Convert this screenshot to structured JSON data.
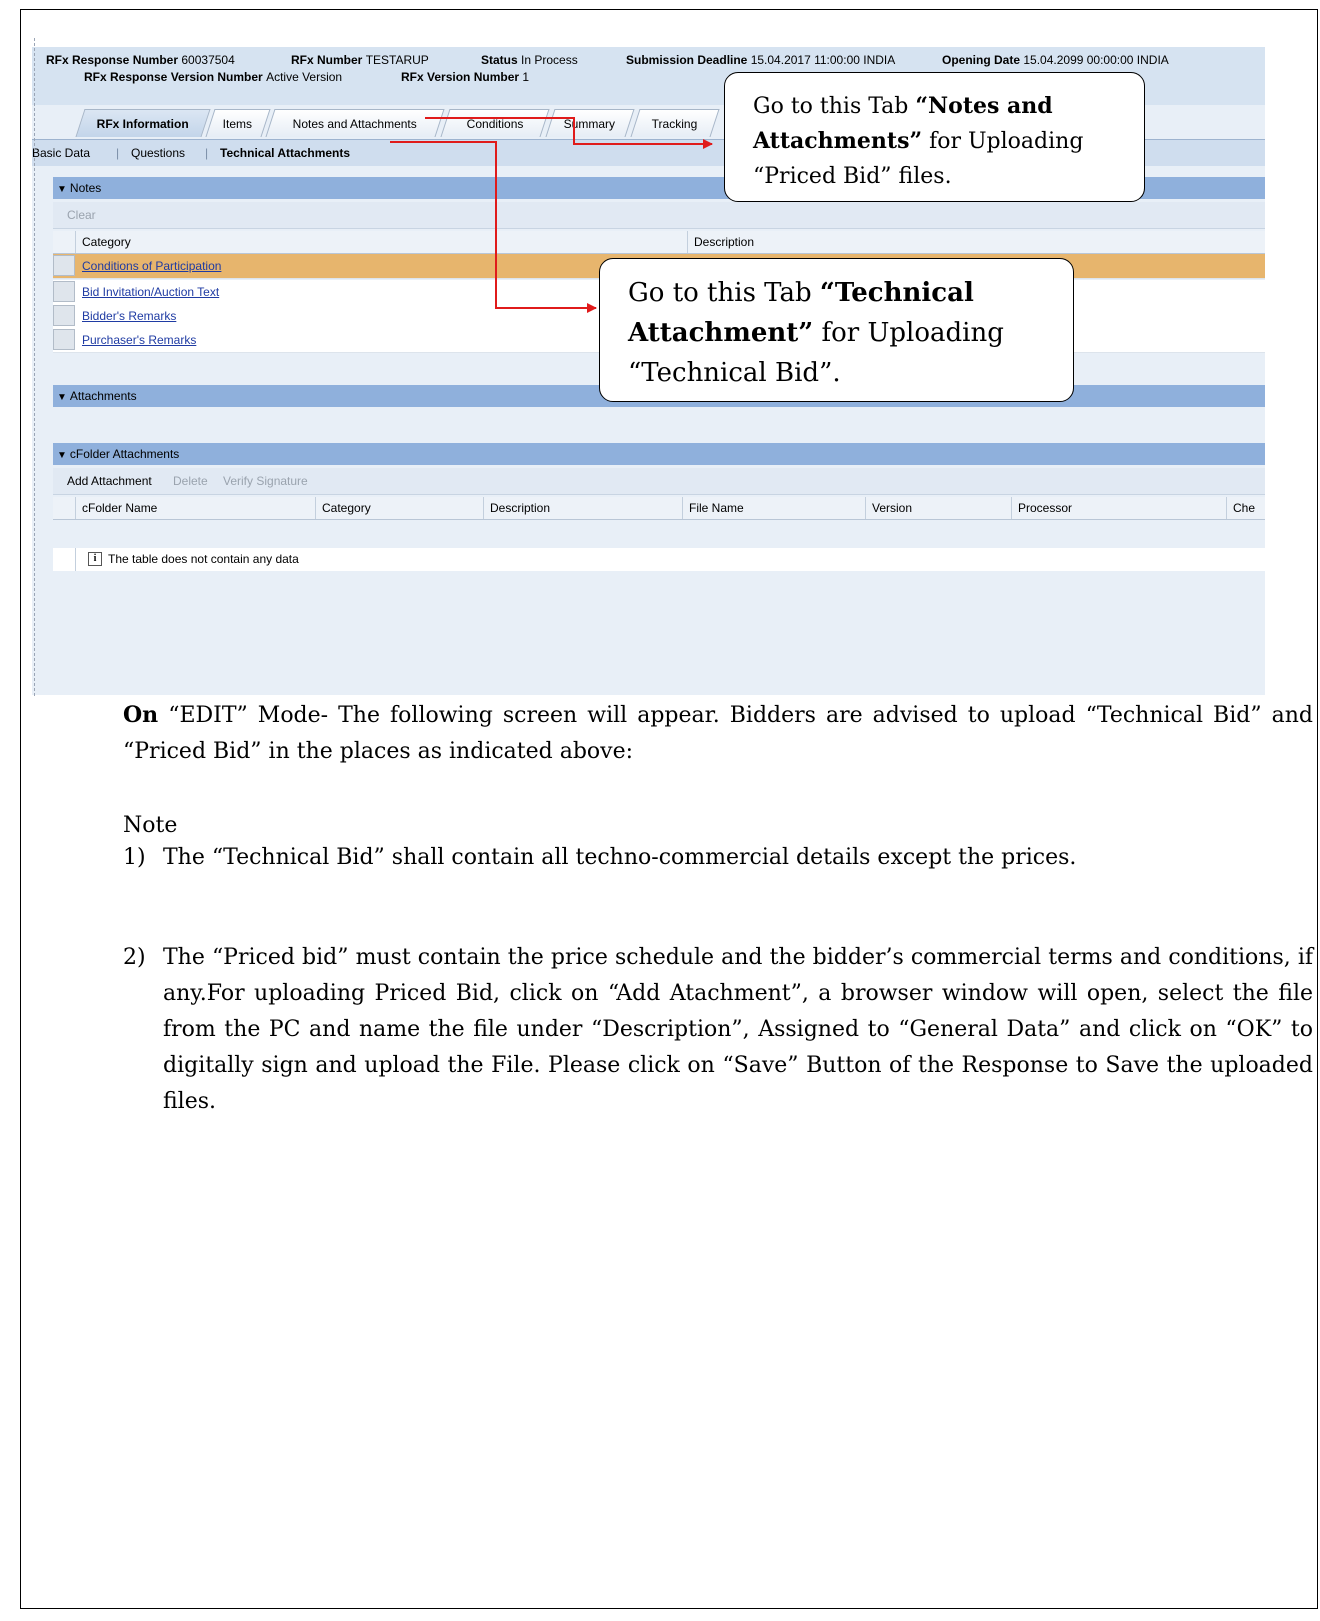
{
  "header": {
    "rfx_response_number_label": "RFx Response Number",
    "rfx_response_number": "60037504",
    "rfx_number_label": "RFx Number",
    "rfx_number": "TESTARUP",
    "status_label": "Status",
    "status": "In Process",
    "submission_deadline_label": "Submission Deadline",
    "submission_deadline": "15.04.2017 11:00:00 INDIA",
    "opening_date_label": "Opening Date",
    "opening_date": "15.04.2099 00:00:00 INDIA",
    "version_number_label": "RFx Response Version Number",
    "version_number": "Active Version",
    "rfx_version_label": "RFx Version Number",
    "rfx_version": "1"
  },
  "tabs": [
    "RFx Information",
    "Items",
    "Notes and Attachments",
    "Conditions",
    "Summary",
    "Tracking"
  ],
  "subnav": [
    "Basic Data",
    "Questions",
    "Technical Attachments"
  ],
  "notes": {
    "title": "Notes",
    "clear": "Clear",
    "col_category": "Category",
    "col_description": "Description",
    "rows": [
      "Conditions of Participation",
      "Bid Invitation/Auction Text",
      "Bidder's Remarks",
      "Purchaser's Remarks"
    ]
  },
  "attachments": {
    "title": "Attachments"
  },
  "cfolder": {
    "title": "cFolder Attachments",
    "add": "Add Attachment",
    "delete": "Delete",
    "verify": "Verify Signature",
    "cols": [
      "cFolder Name",
      "Category",
      "Description",
      "File Name",
      "Version",
      "Processor",
      "Che"
    ],
    "empty": "The table does not contain any data"
  },
  "callout1": {
    "pre": "Go to this Tab ",
    "bold": "“Notes and Attachments”",
    "post": " for Uploading “Priced Bid” files."
  },
  "callout2": {
    "pre": "Go to this Tab ",
    "bold": "“Technical Attachment”",
    "post": " for Uploading “Technical Bid”."
  },
  "body": {
    "on_bold": "On",
    "intro": " “EDIT” Mode- The following screen will appear. Bidders are advised to upload “Technical Bid” and “Priced Bid” in the places as indicated above:",
    "note": "Note",
    "item1_num": "1)",
    "item1": "The “Technical Bid” shall contain all techno-commercial details except the prices.",
    "item2_num": "2)",
    "item2": "The “Priced bid” must contain the price schedule and the bidder’s commercial terms and conditions, if any.For uploading Priced Bid, click on “Add Atachment”, a browser window will open, select the file from the PC and name the file under “Description”, Assigned to “General Data” and click on “OK” to digitally sign and upload the File. Please click on “Save” Button of the Response to Save the uploaded files."
  },
  "colors": {
    "section": "#8fb0dc",
    "highlight_row": "#e7b56d",
    "arrow": "#e01b1b",
    "link": "#1f3ba3"
  }
}
